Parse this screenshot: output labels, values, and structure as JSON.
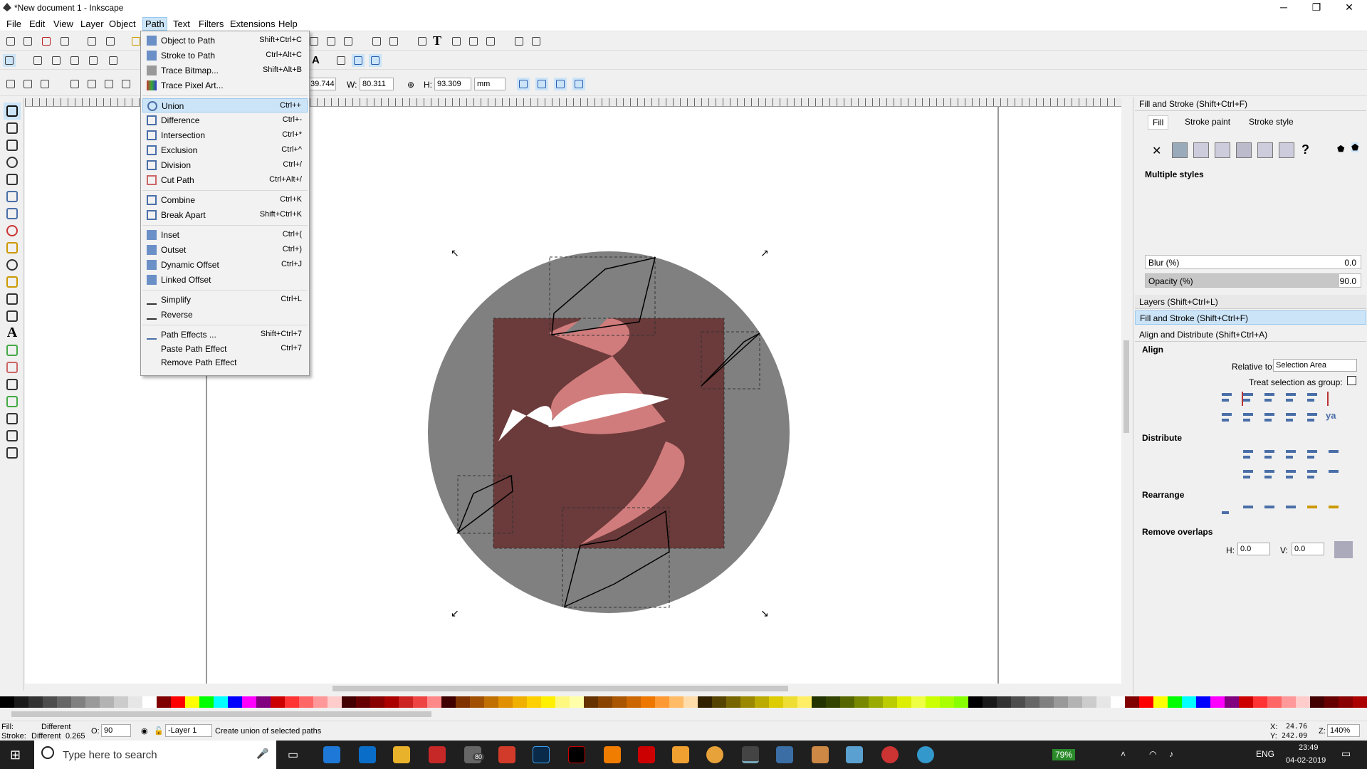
{
  "window": {
    "title": "*New document 1 - Inkscape",
    "min": "─",
    "restore": "❐",
    "close": "✕"
  },
  "menu": [
    "File",
    "Edit",
    "View",
    "Layer",
    "Object",
    "Path",
    "Text",
    "Filters",
    "Extensions",
    "Help"
  ],
  "path_menu": {
    "group1": [
      {
        "label": "Object to Path",
        "shortcut": "Shift+Ctrl+C"
      },
      {
        "label": "Stroke to Path",
        "shortcut": "Ctrl+Alt+C"
      },
      {
        "label": "Trace Bitmap...",
        "shortcut": "Shift+Alt+B"
      },
      {
        "label": "Trace Pixel Art...",
        "shortcut": ""
      }
    ],
    "group2": [
      {
        "label": "Union",
        "shortcut": "Ctrl++"
      },
      {
        "label": "Difference",
        "shortcut": "Ctrl+-"
      },
      {
        "label": "Intersection",
        "shortcut": "Ctrl+*"
      },
      {
        "label": "Exclusion",
        "shortcut": "Ctrl+^"
      },
      {
        "label": "Division",
        "shortcut": "Ctrl+/"
      },
      {
        "label": "Cut Path",
        "shortcut": "Ctrl+Alt+/"
      }
    ],
    "group3": [
      {
        "label": "Combine",
        "shortcut": "Ctrl+K"
      },
      {
        "label": "Break Apart",
        "shortcut": "Shift+Ctrl+K"
      }
    ],
    "group4": [
      {
        "label": "Inset",
        "shortcut": "Ctrl+("
      },
      {
        "label": "Outset",
        "shortcut": "Ctrl+)"
      },
      {
        "label": "Dynamic Offset",
        "shortcut": "Ctrl+J"
      },
      {
        "label": "Linked Offset",
        "shortcut": ""
      }
    ],
    "group5": [
      {
        "label": "Simplify",
        "shortcut": "Ctrl+L"
      },
      {
        "label": "Reverse",
        "shortcut": ""
      }
    ],
    "group6": [
      {
        "label": "Path Effects ...",
        "shortcut": "Shift+Ctrl+7"
      },
      {
        "label": "Paste Path Effect",
        "shortcut": "Ctrl+7"
      },
      {
        "label": "Remove Path Effect",
        "shortcut": ""
      }
    ]
  },
  "selector_bar": {
    "x_value": "39.744",
    "w_label": "W:",
    "w_value": "80.311",
    "h_label": "H:",
    "h_value": "93.309",
    "unit": "mm"
  },
  "fill_stroke": {
    "title": "Fill and Stroke (Shift+Ctrl+F)",
    "tab_fill": "Fill",
    "tab_stroke_paint": "Stroke paint",
    "tab_stroke_style": "Stroke style",
    "unknown": "?",
    "state": "Multiple styles",
    "blur_label": "Blur (%)",
    "blur_value": "0.0",
    "opacity_label": "Opacity (%)",
    "opacity_value": "90.0",
    "opacity_level": 0.9
  },
  "collapsed": {
    "layers": "Layers (Shift+Ctrl+L)",
    "fill": "Fill and Stroke (Shift+Ctrl+F)"
  },
  "align": {
    "title": "Align and Distribute (Shift+Ctrl+A)",
    "align_heading": "Align",
    "relative_label": "Relative to:",
    "relative_value": "Selection Area",
    "treat_label": "Treat selection as group:",
    "distribute_heading": "Distribute",
    "rearrange_heading": "Rearrange",
    "overlaps_heading": "Remove overlaps",
    "h_label": "H:",
    "h_value": "0.0",
    "v_label": "V:",
    "v_value": "0.0"
  },
  "status": {
    "fill_label": "Fill:",
    "fill_value": "Different",
    "stroke_label": "Stroke:",
    "stroke_value": "Different",
    "stroke_width": "0.265",
    "o_label": "O:",
    "o_value": "90",
    "layer": "-Layer 1",
    "message": "Create union of selected paths",
    "x_label": "X:",
    "x_value": "24.76",
    "y_label": "Y:",
    "y_value": "242.09",
    "z_label": "Z:",
    "zoom": "140%"
  },
  "taskbar": {
    "search_placeholder": "Type here to search",
    "battery": "79%",
    "lang": "ENG",
    "time": "23:49",
    "date": "04-02-2019",
    "badge": "80"
  },
  "colors": {
    "accent": "#cce4f7",
    "shape_grey": "#808080",
    "shape_pink": "#d17c7c",
    "shape_dark": "#6b3a3a"
  }
}
